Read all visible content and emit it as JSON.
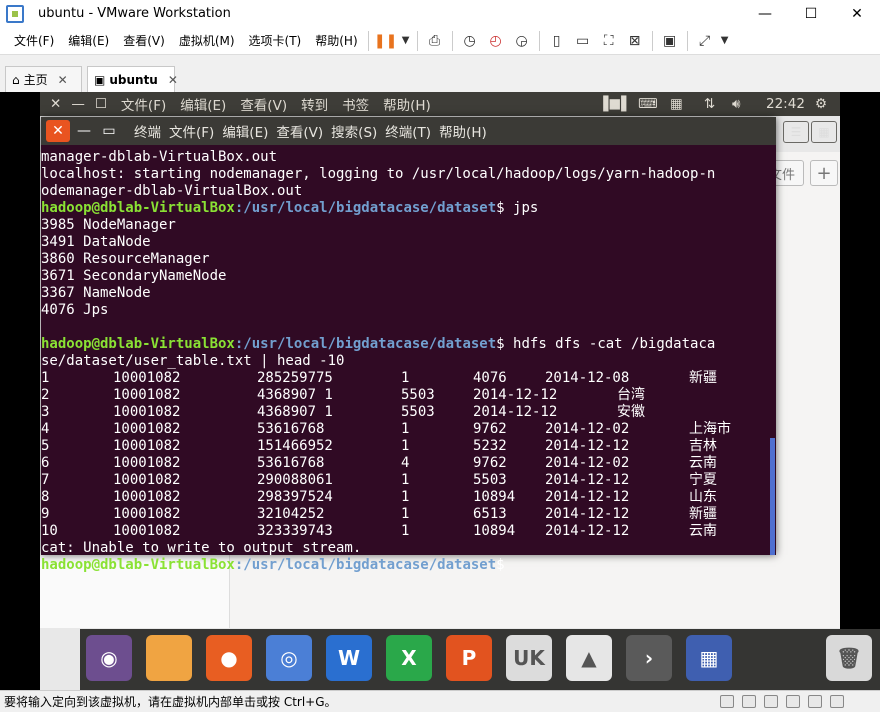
{
  "window": {
    "title": "ubuntu - VMware Workstation",
    "minimize": "—",
    "maximize": "☐",
    "close": "✕"
  },
  "menu": [
    {
      "label": "文件(F)"
    },
    {
      "label": "编辑(E)"
    },
    {
      "label": "查看(V)"
    },
    {
      "label": "虚拟机(M)"
    },
    {
      "label": "选项卡(T)"
    },
    {
      "label": "帮助(H)"
    }
  ],
  "tabs": [
    {
      "label": "主页",
      "icon": "home-icon"
    },
    {
      "label": "ubuntu",
      "icon": "vm-icon"
    }
  ],
  "tab_close": "✕",
  "guest_topbar": {
    "menus": [
      "文件(F)",
      "编辑(E)",
      "查看(V)",
      "转到",
      "书签",
      "帮助(H)"
    ],
    "clock": "22:42"
  },
  "behind_window": {
    "button_label": "文件",
    "plus": "+"
  },
  "terminal": {
    "title": "终端",
    "menus": [
      "文件(F)",
      "编辑(E)",
      "查看(V)",
      "搜索(S)",
      "终端(T)",
      "帮助(H)"
    ],
    "prompt_user": "hadoop@dblab-VirtualBox",
    "prompt_path": ":/usr/local/bigdatacase/dataset",
    "lines_before": [
      "manager-dblab-VirtualBox.out",
      "localhost: starting nodemanager, logging to /usr/local/hadoop/logs/yarn-hadoop-n",
      "odemanager-dblab-VirtualBox.out"
    ],
    "cmd1": "$ jps",
    "jps_output": [
      "3985 NodeManager",
      "3491 DataNode",
      "3860 ResourceManager",
      "3671 SecondaryNameNode",
      "3367 NameNode",
      "4076 Jps"
    ],
    "cmd2": "$ hdfs dfs -cat /bigdataca",
    "cmd2_cont": "se/dataset/user_table.txt | head -10",
    "rows": [
      {
        "id": "1",
        "uid": "10001082",
        "item": "285259775",
        "beh": "1",
        "cat": "4076",
        "date": "2014-12-08",
        "prov": "新疆",
        "shift": false
      },
      {
        "id": "2",
        "uid": "10001082",
        "item": "4368907 1",
        "beh": "5503",
        "cat": "2014-12-12",
        "date": "台湾",
        "prov": "",
        "shift": true
      },
      {
        "id": "3",
        "uid": "10001082",
        "item": "4368907 1",
        "beh": "5503",
        "cat": "2014-12-12",
        "date": "安徽",
        "prov": "",
        "shift": true
      },
      {
        "id": "4",
        "uid": "10001082",
        "item": "53616768",
        "beh": "1",
        "cat": "9762",
        "date": "2014-12-02",
        "prov": "上海市",
        "shift": false
      },
      {
        "id": "5",
        "uid": "10001082",
        "item": "151466952",
        "beh": "1",
        "cat": "5232",
        "date": "2014-12-12",
        "prov": "吉林",
        "shift": false
      },
      {
        "id": "6",
        "uid": "10001082",
        "item": "53616768",
        "beh": "4",
        "cat": "9762",
        "date": "2014-12-02",
        "prov": "云南",
        "shift": false
      },
      {
        "id": "7",
        "uid": "10001082",
        "item": "290088061",
        "beh": "1",
        "cat": "5503",
        "date": "2014-12-12",
        "prov": "宁夏",
        "shift": false
      },
      {
        "id": "8",
        "uid": "10001082",
        "item": "298397524",
        "beh": "1",
        "cat": "10894",
        "date": "2014-12-12",
        "prov": "山东",
        "shift": false
      },
      {
        "id": "9",
        "uid": "10001082",
        "item": "32104252",
        "beh": "1",
        "cat": "6513",
        "date": "2014-12-12",
        "prov": "新疆",
        "shift": false
      },
      {
        "id": "10",
        "uid": "10001082",
        "item": "323339743",
        "beh": "1",
        "cat": "10894",
        "date": "2014-12-12",
        "prov": "云南",
        "shift": false
      }
    ],
    "error_line": "cat: Unable to write to output stream.",
    "final_prompt": "$"
  },
  "dock": [
    {
      "name": "ubuntu-launcher-icon",
      "color": "#6d4e8f",
      "glyph": "◉"
    },
    {
      "name": "files-icon",
      "color": "#f0a442",
      "glyph": ""
    },
    {
      "name": "firefox-icon",
      "color": "#e85e22",
      "glyph": "●"
    },
    {
      "name": "chromium-icon",
      "color": "#4b7fd6",
      "glyph": "◎"
    },
    {
      "name": "writer-icon",
      "color": "#2a6fd0",
      "glyph": "W"
    },
    {
      "name": "calc-icon",
      "color": "#2aa84a",
      "glyph": "X"
    },
    {
      "name": "impress-icon",
      "color": "#e2531f",
      "glyph": "P"
    },
    {
      "name": "software-center-icon",
      "color": "#dcdcdc",
      "glyph": "UK"
    },
    {
      "name": "amazon-icon",
      "color": "#e6e6e6",
      "glyph": "▲"
    },
    {
      "name": "terminal-icon",
      "color": "#5a5a5a",
      "glyph": "›"
    },
    {
      "name": "workspaces-icon",
      "color": "#3f5fb0",
      "glyph": "▦"
    },
    {
      "name": "trash-icon",
      "color": "#d9d9d9",
      "glyph": "🗑"
    }
  ],
  "status": {
    "text": "要将输入定向到该虚拟机，请在虚拟机内部单击或按 Ctrl+G。"
  }
}
